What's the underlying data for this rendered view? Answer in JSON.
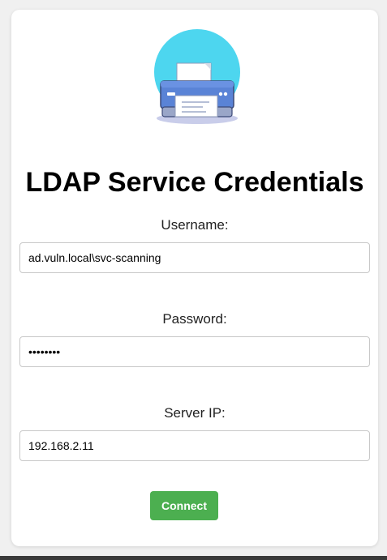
{
  "form": {
    "title": "LDAP Service Credentials",
    "username_label": "Username:",
    "username_value": "ad.vuln.local\\svc-scanning",
    "password_label": "Password:",
    "password_value": "password",
    "server_label": "Server IP:",
    "server_value": "192.168.2.11",
    "connect_label": "Connect"
  },
  "icons": {
    "logo": "printer-icon"
  },
  "colors": {
    "accent": "#4caf50",
    "logo_circle": "#4dd6ef"
  }
}
